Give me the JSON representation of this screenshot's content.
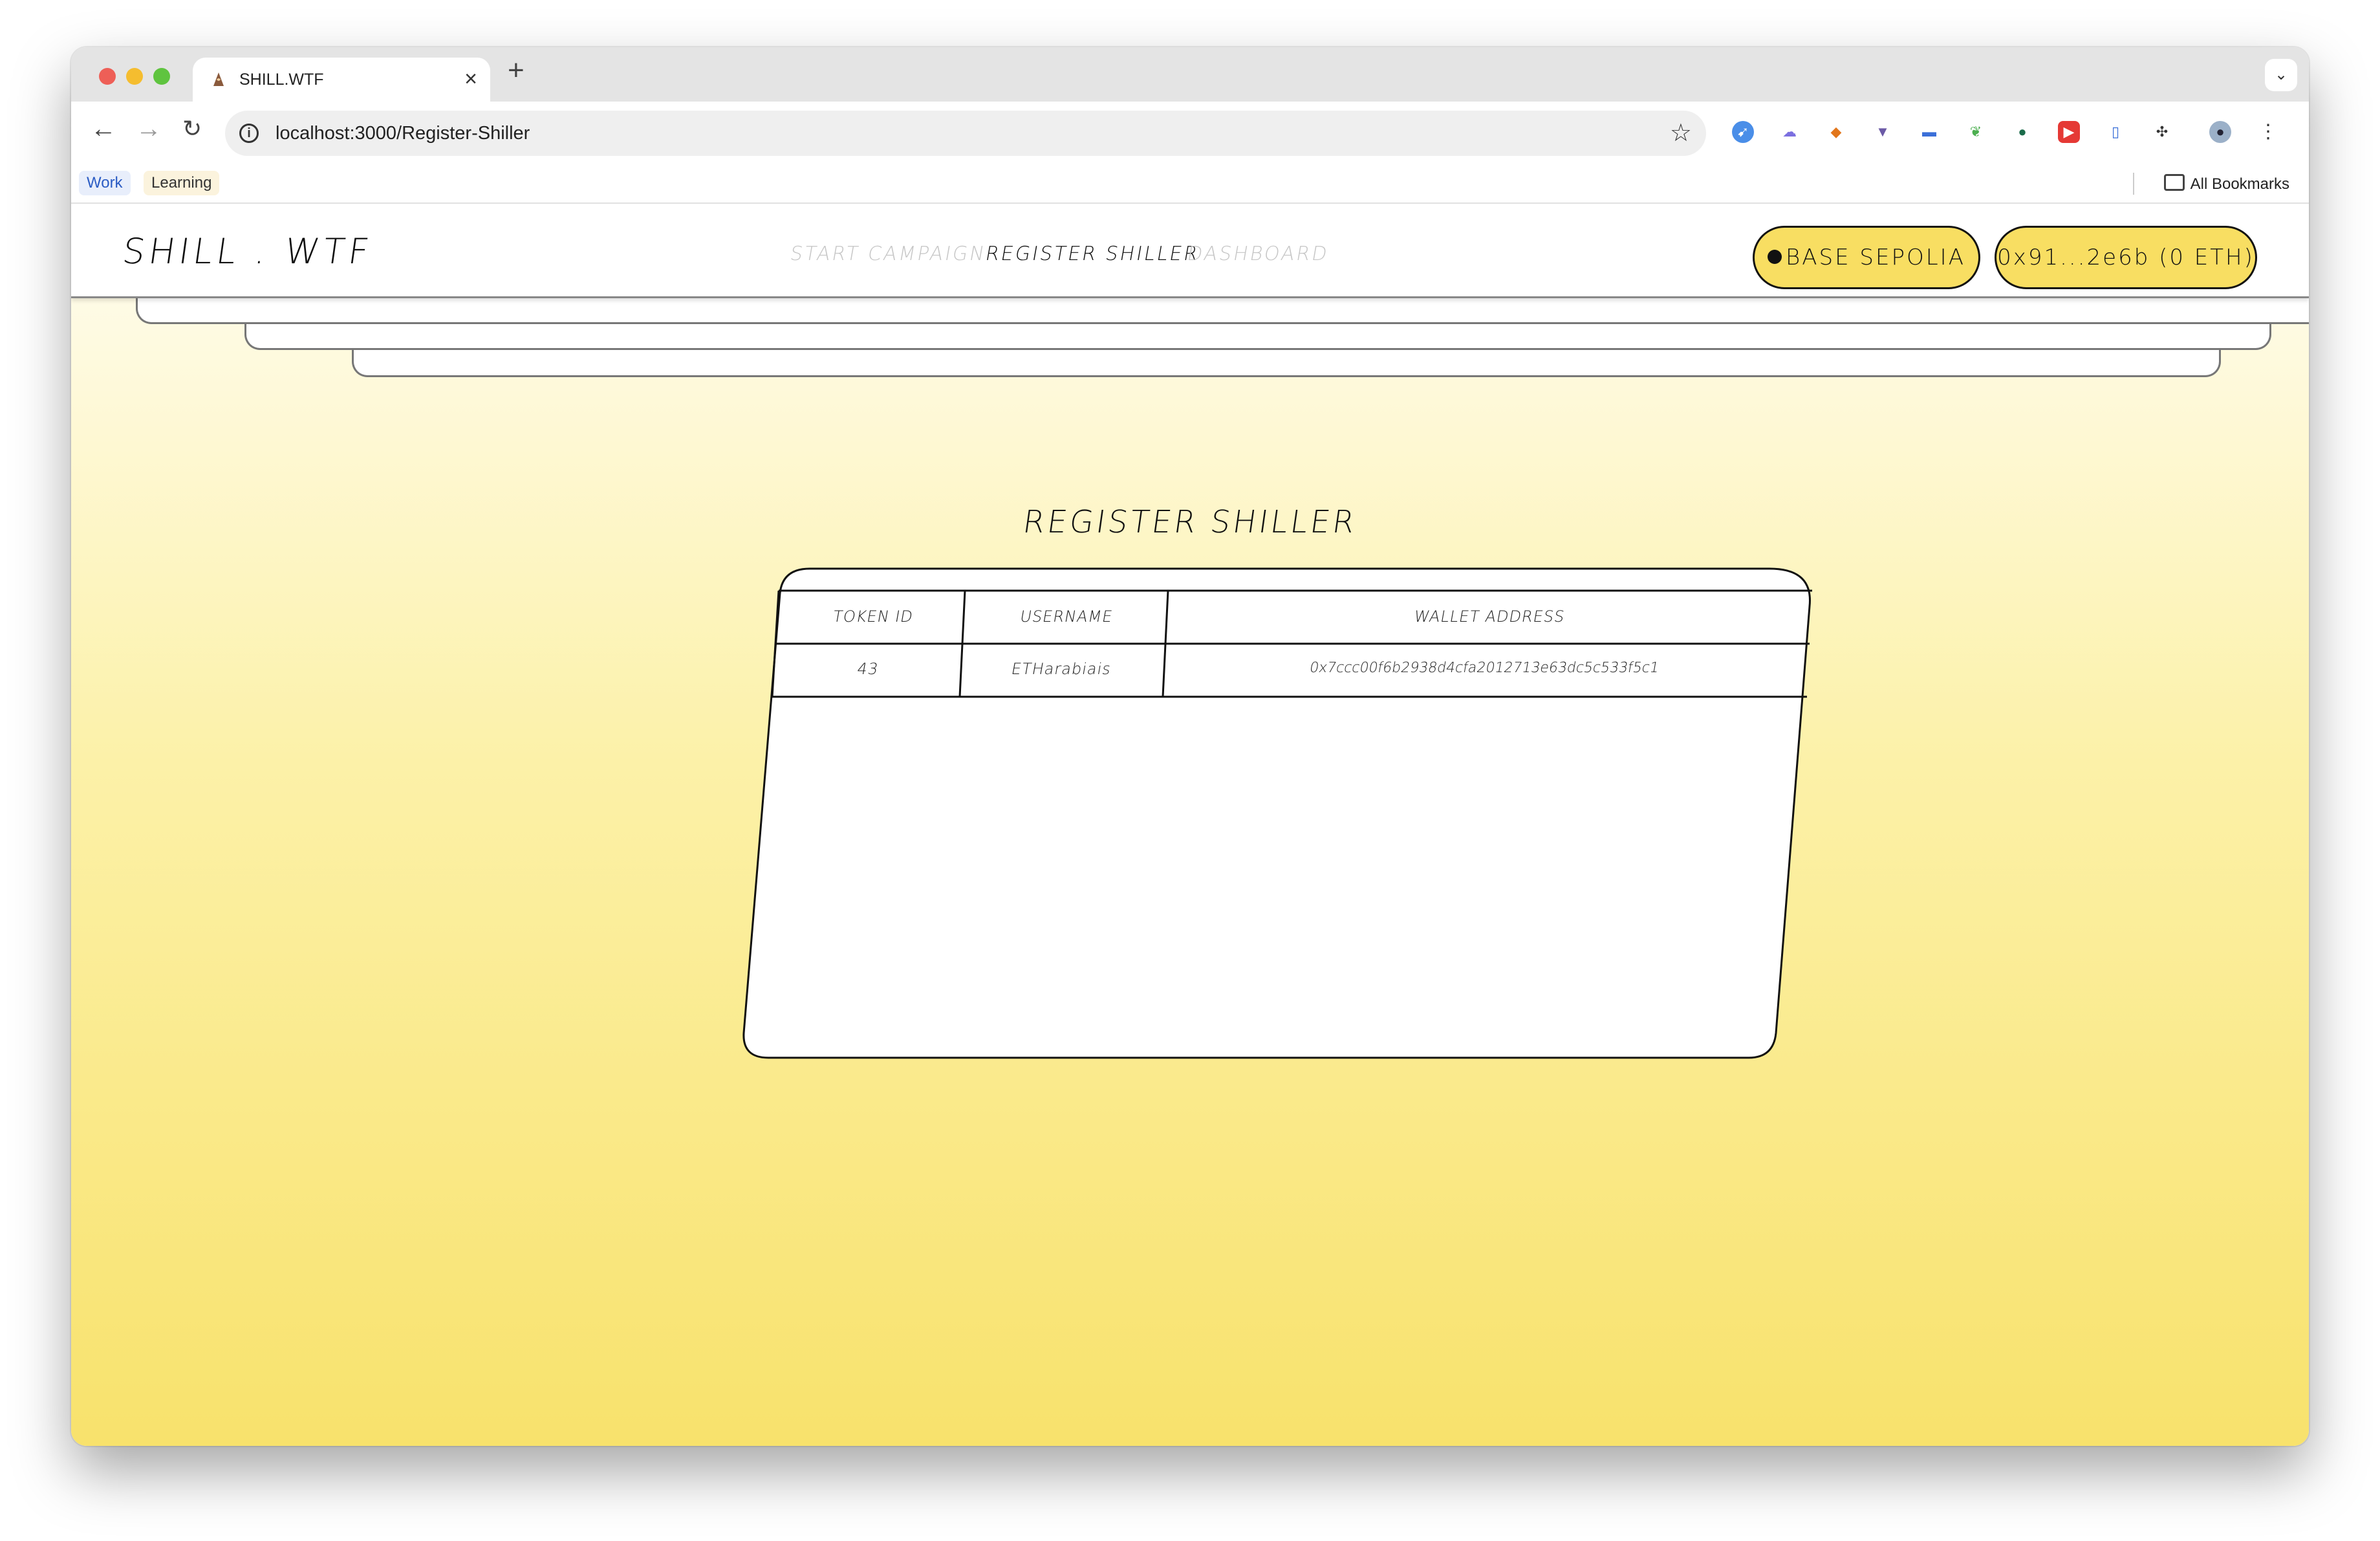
{
  "browser": {
    "tab_title": "SHILL.WTF",
    "new_tab": "+",
    "close": "×",
    "url": "localhost:3000/Register-Shiller",
    "bookmarks": [
      "Work",
      "Learning"
    ],
    "all_bookmarks": "All Bookmarks"
  },
  "app": {
    "brand": "SHILL . WTF",
    "nav": [
      "START CAMPAIGN",
      "REGISTER SHILLER",
      "DASHBOARD"
    ],
    "active_nav": "REGISTER SHILLER",
    "network_button": "BASE SEPOLIA",
    "wallet_button": "0x91...2e6b (0 ETH)"
  },
  "main": {
    "title": "REGISTER SHILLER",
    "table": {
      "headers": [
        "TOKEN ID",
        "USERNAME",
        "WALLET ADDRESS"
      ],
      "rows": [
        [
          "43",
          "ETHarabiais",
          "0x7ccc00f6b2938d4cfa2012713e63dc5c533f5c1"
        ]
      ]
    }
  },
  "colors": {
    "accent_yellow": "#f8de62",
    "gradient_end": "#f8e26c"
  }
}
